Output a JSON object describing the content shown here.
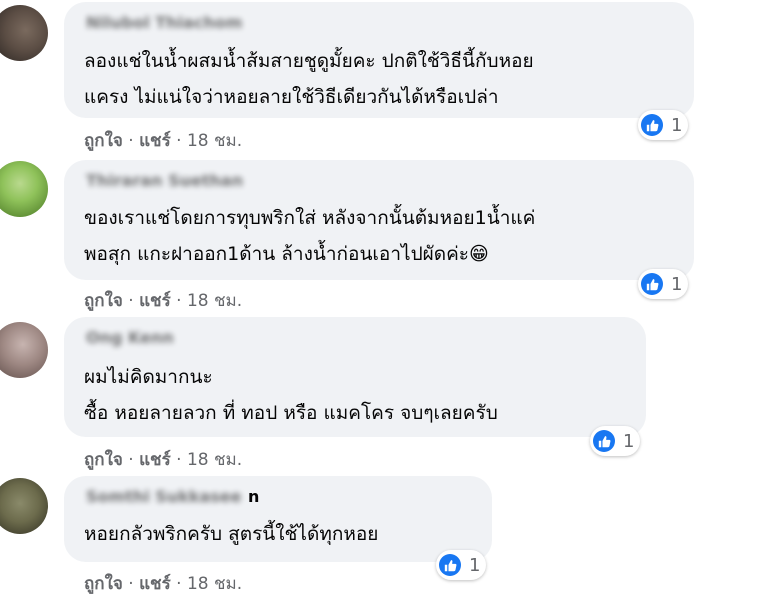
{
  "comments": [
    {
      "author": "Nilubol Thiachom",
      "author_tail": "",
      "lines": [
        "ลองแช่ในน้ำผสมน้ำส้มสายชูดูมั้ยคะ ปกติใช้วิธีนี้กับหอย",
        "แครง ไม่แน่ใจว่าหอยลายใช้วิธีเดียวกันได้หรือเปล่า"
      ],
      "reaction_count": "1",
      "like_label": "ถูกใจ",
      "share_label": "แชร์",
      "time": "18 ชม."
    },
    {
      "author": "Thiraran Suethan",
      "author_tail": "",
      "lines": [
        "ของเราแช่โดยการทุบพริกใส่ หลังจากนั้นต้มหอย1น้ำแค่",
        "พอสุก แกะฝาออก1ด้าน ล้างน้ำก่อนเอาไปผัดค่ะ😁"
      ],
      "reaction_count": "1",
      "like_label": "ถูกใจ",
      "share_label": "แชร์",
      "time": "18 ชม."
    },
    {
      "author": "Ong Kenn",
      "author_tail": "",
      "lines": [
        "ผมไม่คิดมากนะ",
        "ซื้อ หอยลายลวก ที่ ทอป หรือ แมคโคร จบๆเลยครับ"
      ],
      "reaction_count": "1",
      "like_label": "ถูกใจ",
      "share_label": "แชร์",
      "time": "18 ชม."
    },
    {
      "author": "Somthi Sukkasee",
      "author_tail": "n",
      "lines": [
        "หอยกลัวพริกครับ สูตรนี้ใช้ได้ทุกหอย"
      ],
      "reaction_count": "1",
      "like_label": "ถูกใจ",
      "share_label": "แชร์",
      "time": "18 ชม."
    }
  ],
  "separator": "·",
  "colors": {
    "like_blue": "#1877f2",
    "bubble": "#f0f2f5",
    "meta_text": "#65676b"
  },
  "icons": {
    "reaction": "thumbs-up-icon",
    "avatar": "avatar"
  }
}
